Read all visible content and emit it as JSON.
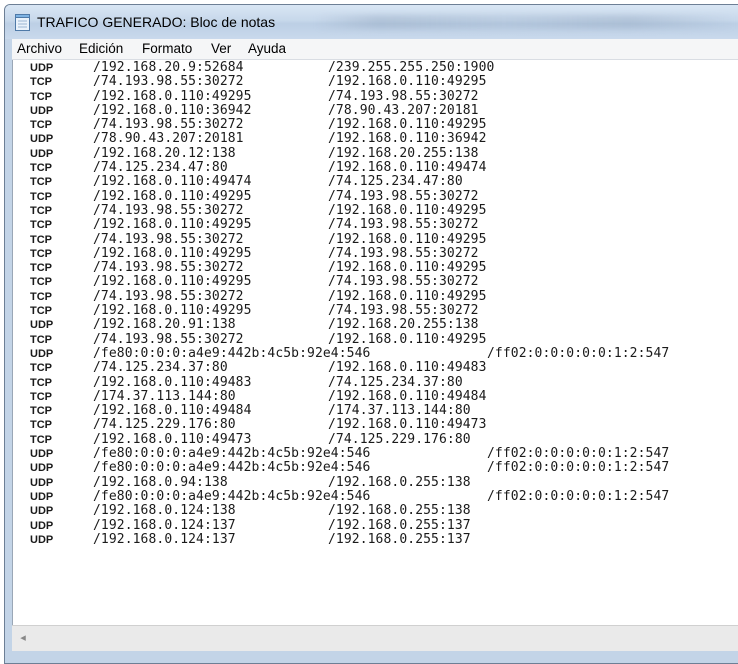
{
  "window": {
    "title": "TRAFICO GENERADO: Bloc de notas"
  },
  "menu": {
    "items": [
      "Archivo",
      "Edición",
      "Formato",
      "Ver",
      "Ayuda"
    ]
  },
  "content": {
    "lines": [
      {
        "proto": "UDP",
        "src": "/192.168.20.9:52684",
        "dst": "/239.255.255.250:1900"
      },
      {
        "proto": "TCP",
        "src": "/74.193.98.55:30272",
        "dst": "/192.168.0.110:49295"
      },
      {
        "proto": "TCP",
        "src": "/192.168.0.110:49295",
        "dst": "/74.193.98.55:30272"
      },
      {
        "proto": "UDP",
        "src": "/192.168.0.110:36942",
        "dst": "/78.90.43.207:20181"
      },
      {
        "proto": "TCP",
        "src": "/74.193.98.55:30272",
        "dst": "/192.168.0.110:49295"
      },
      {
        "proto": "UDP",
        "src": "/78.90.43.207:20181",
        "dst": "/192.168.0.110:36942"
      },
      {
        "proto": "UDP",
        "src": "/192.168.20.12:138",
        "dst": "/192.168.20.255:138"
      },
      {
        "proto": "TCP",
        "src": "/74.125.234.47:80",
        "dst": "/192.168.0.110:49474"
      },
      {
        "proto": "TCP",
        "src": "/192.168.0.110:49474",
        "dst": "/74.125.234.47:80"
      },
      {
        "proto": "TCP",
        "src": "/192.168.0.110:49295",
        "dst": "/74.193.98.55:30272"
      },
      {
        "proto": "TCP",
        "src": "/74.193.98.55:30272",
        "dst": "/192.168.0.110:49295"
      },
      {
        "proto": "TCP",
        "src": "/192.168.0.110:49295",
        "dst": "/74.193.98.55:30272"
      },
      {
        "proto": "TCP",
        "src": "/74.193.98.55:30272",
        "dst": "/192.168.0.110:49295"
      },
      {
        "proto": "TCP",
        "src": "/192.168.0.110:49295",
        "dst": "/74.193.98.55:30272"
      },
      {
        "proto": "TCP",
        "src": "/74.193.98.55:30272",
        "dst": "/192.168.0.110:49295"
      },
      {
        "proto": "TCP",
        "src": "/192.168.0.110:49295",
        "dst": "/74.193.98.55:30272"
      },
      {
        "proto": "TCP",
        "src": "/74.193.98.55:30272",
        "dst": "/192.168.0.110:49295"
      },
      {
        "proto": "TCP",
        "src": "/192.168.0.110:49295",
        "dst": "/74.193.98.55:30272"
      },
      {
        "proto": "UDP",
        "src": "/192.168.20.91:138",
        "dst": "/192.168.20.255:138"
      },
      {
        "proto": "TCP",
        "src": "/74.193.98.55:30272",
        "dst": "/192.168.0.110:49295"
      },
      {
        "proto": "UDP",
        "src": "/fe80:0:0:0:a4e9:442b:4c5b:92e4:546",
        "dst": "/ff02:0:0:0:0:0:1:2:547"
      },
      {
        "proto": "TCP",
        "src": "/74.125.234.37:80",
        "dst": "/192.168.0.110:49483"
      },
      {
        "proto": "TCP",
        "src": "/192.168.0.110:49483",
        "dst": "/74.125.234.37:80"
      },
      {
        "proto": "TCP",
        "src": "/174.37.113.144:80",
        "dst": "/192.168.0.110:49484"
      },
      {
        "proto": "TCP",
        "src": "/192.168.0.110:49484",
        "dst": "/174.37.113.144:80"
      },
      {
        "proto": "TCP",
        "src": "/74.125.229.176:80",
        "dst": "/192.168.0.110:49473"
      },
      {
        "proto": "TCP",
        "src": "/192.168.0.110:49473",
        "dst": "/74.125.229.176:80"
      },
      {
        "proto": "UDP",
        "src": "/fe80:0:0:0:a4e9:442b:4c5b:92e4:546",
        "dst": "/ff02:0:0:0:0:0:1:2:547"
      },
      {
        "proto": "UDP",
        "src": "/fe80:0:0:0:a4e9:442b:4c5b:92e4:546",
        "dst": "/ff02:0:0:0:0:0:1:2:547"
      },
      {
        "proto": "UDP",
        "src": "/192.168.0.94:138",
        "dst": "/192.168.0.255:138"
      },
      {
        "proto": "UDP",
        "src": "/fe80:0:0:0:a4e9:442b:4c5b:92e4:546",
        "dst": "/ff02:0:0:0:0:0:1:2:547"
      },
      {
        "proto": "UDP",
        "src": "/192.168.0.124:138",
        "dst": "/192.168.0.255:138"
      },
      {
        "proto": "UDP",
        "src": "/192.168.0.124:137",
        "dst": "/192.168.0.255:137"
      },
      {
        "proto": "UDP",
        "src": "/192.168.0.124:137",
        "dst": "/192.168.0.255:137"
      }
    ]
  },
  "scrollbar": {
    "left_arrow_icon": "chevron-left-icon"
  }
}
